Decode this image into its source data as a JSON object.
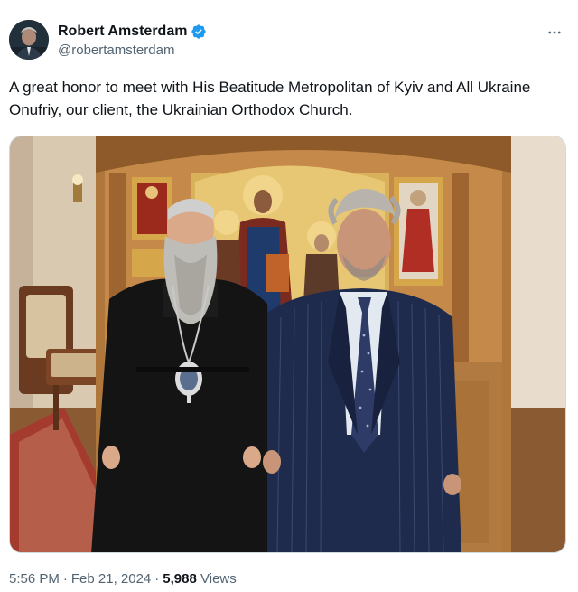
{
  "author": {
    "display_name": "Robert Amsterdam",
    "handle": "@robertamsterdam",
    "verified": true
  },
  "tweet": {
    "text": "A great honor to meet with His Beatitude Metropolitan of Kyiv and All Ukraine Onufriy, our client, the Ukrainian Orthodox Church."
  },
  "meta": {
    "time": "5:56 PM",
    "dot": "·",
    "date": "Feb 21, 2024",
    "views_count": "5,988",
    "views_label": "Views"
  },
  "icons": {
    "verified": "verified-badge-icon",
    "more": "more-options-icon"
  },
  "colors": {
    "verified_blue": "#1d9bf0",
    "secondary_text": "#536471",
    "primary_text": "#0f1419",
    "border": "#cfd9de"
  }
}
